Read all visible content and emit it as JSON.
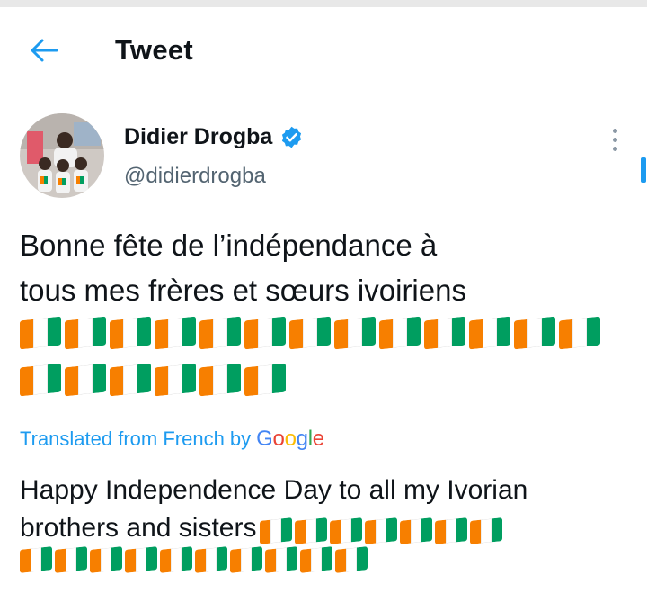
{
  "header": {
    "title": "Tweet",
    "back_icon": "arrow-left-icon"
  },
  "author": {
    "name": "Didier Drogba",
    "handle": "@didierdrogba",
    "verified": true
  },
  "tweet": {
    "line1": "Bonne fête de l’indépendance à",
    "line2": "tous mes frères et sœurs ivoiriens",
    "flag_emoji": "🇨🇮",
    "flag_count_row1": 13,
    "flag_count_row2": 6
  },
  "translation": {
    "label": "Translated from French by",
    "provider": "Google",
    "line1": "Happy Independence Day to all my Ivorian",
    "line2": "brothers and sisters",
    "flag_count_row1": 7,
    "flag_count_row2": 10
  },
  "colors": {
    "accent": "#1d9bf0",
    "flag_orange": "#f77f00",
    "flag_green": "#009e60"
  }
}
